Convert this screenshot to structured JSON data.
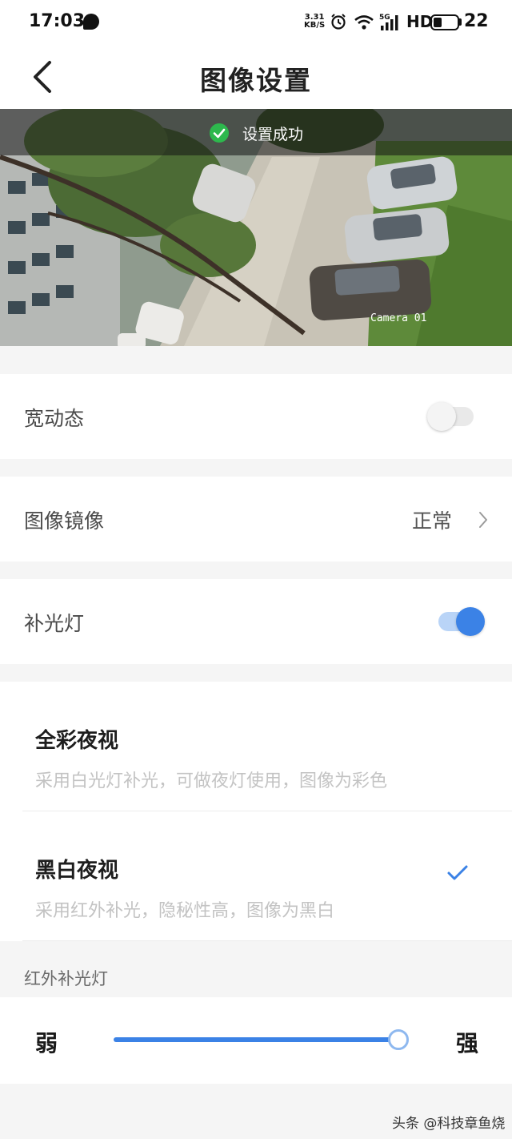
{
  "status_bar": {
    "time": "17:03",
    "net_speed_value": "3.31",
    "net_speed_unit": "KB/S",
    "network": "5G",
    "hd": "HD",
    "battery": "22"
  },
  "header": {
    "title": "图像设置",
    "back_icon": "chevron-left-icon"
  },
  "preview": {
    "toast_text": "设置成功",
    "toast_icon": "check-circle-icon",
    "camera_label": "Camera 01"
  },
  "settings": {
    "wdr": {
      "label": "宽动态",
      "enabled": false
    },
    "mirror": {
      "label": "图像镜像",
      "value": "正常"
    },
    "fill_light": {
      "label": "补光灯",
      "enabled": true
    }
  },
  "night_modes": [
    {
      "title": "全彩夜视",
      "desc": "采用白光灯补光，可做夜灯使用，图像为彩色",
      "selected": false
    },
    {
      "title": "黑白夜视",
      "desc": "采用红外补光，隐秘性高，图像为黑白",
      "selected": true
    }
  ],
  "ir_light": {
    "section_label": "红外补光灯",
    "min_label": "弱",
    "max_label": "强",
    "level": 1.0
  },
  "watermark": "头条 @科技章鱼烧",
  "colors": {
    "accent": "#3b82e6",
    "toggle_on_track": "#b9d4f7",
    "toggle_off_track": "#e6e6e6",
    "success": "#2db84d"
  }
}
